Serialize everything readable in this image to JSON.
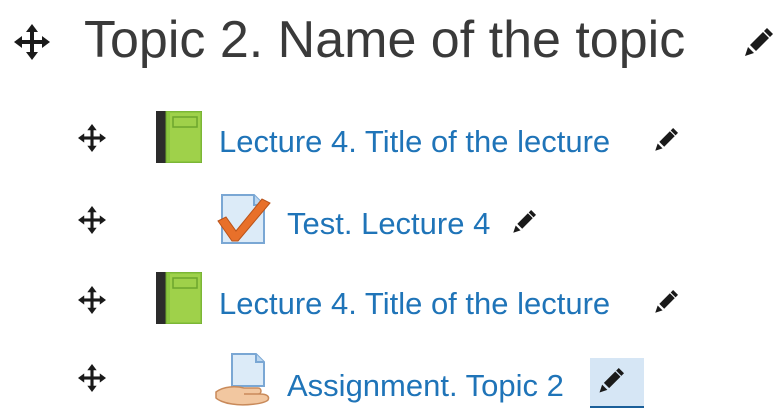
{
  "section": {
    "title": "Topic 2. Name of the topic"
  },
  "activities": [
    {
      "type": "book",
      "icon": "book-icon",
      "label": "Lecture 4. Title of the lecture"
    },
    {
      "type": "quiz",
      "icon": "quiz-icon",
      "label": "Test. Lecture 4"
    },
    {
      "type": "book",
      "icon": "book-icon",
      "label": "Lecture 4. Title of the lecture"
    },
    {
      "type": "assignment",
      "icon": "assignment-icon",
      "label": "Assignment. Topic 2"
    }
  ],
  "colors": {
    "link": "#1f74b8",
    "title": "#3a3a3a",
    "icon_dark": "#1a1a1a",
    "book_green": "#8cc63f",
    "quiz_check": "#e8702a",
    "highlight": "#d6e6f5"
  }
}
